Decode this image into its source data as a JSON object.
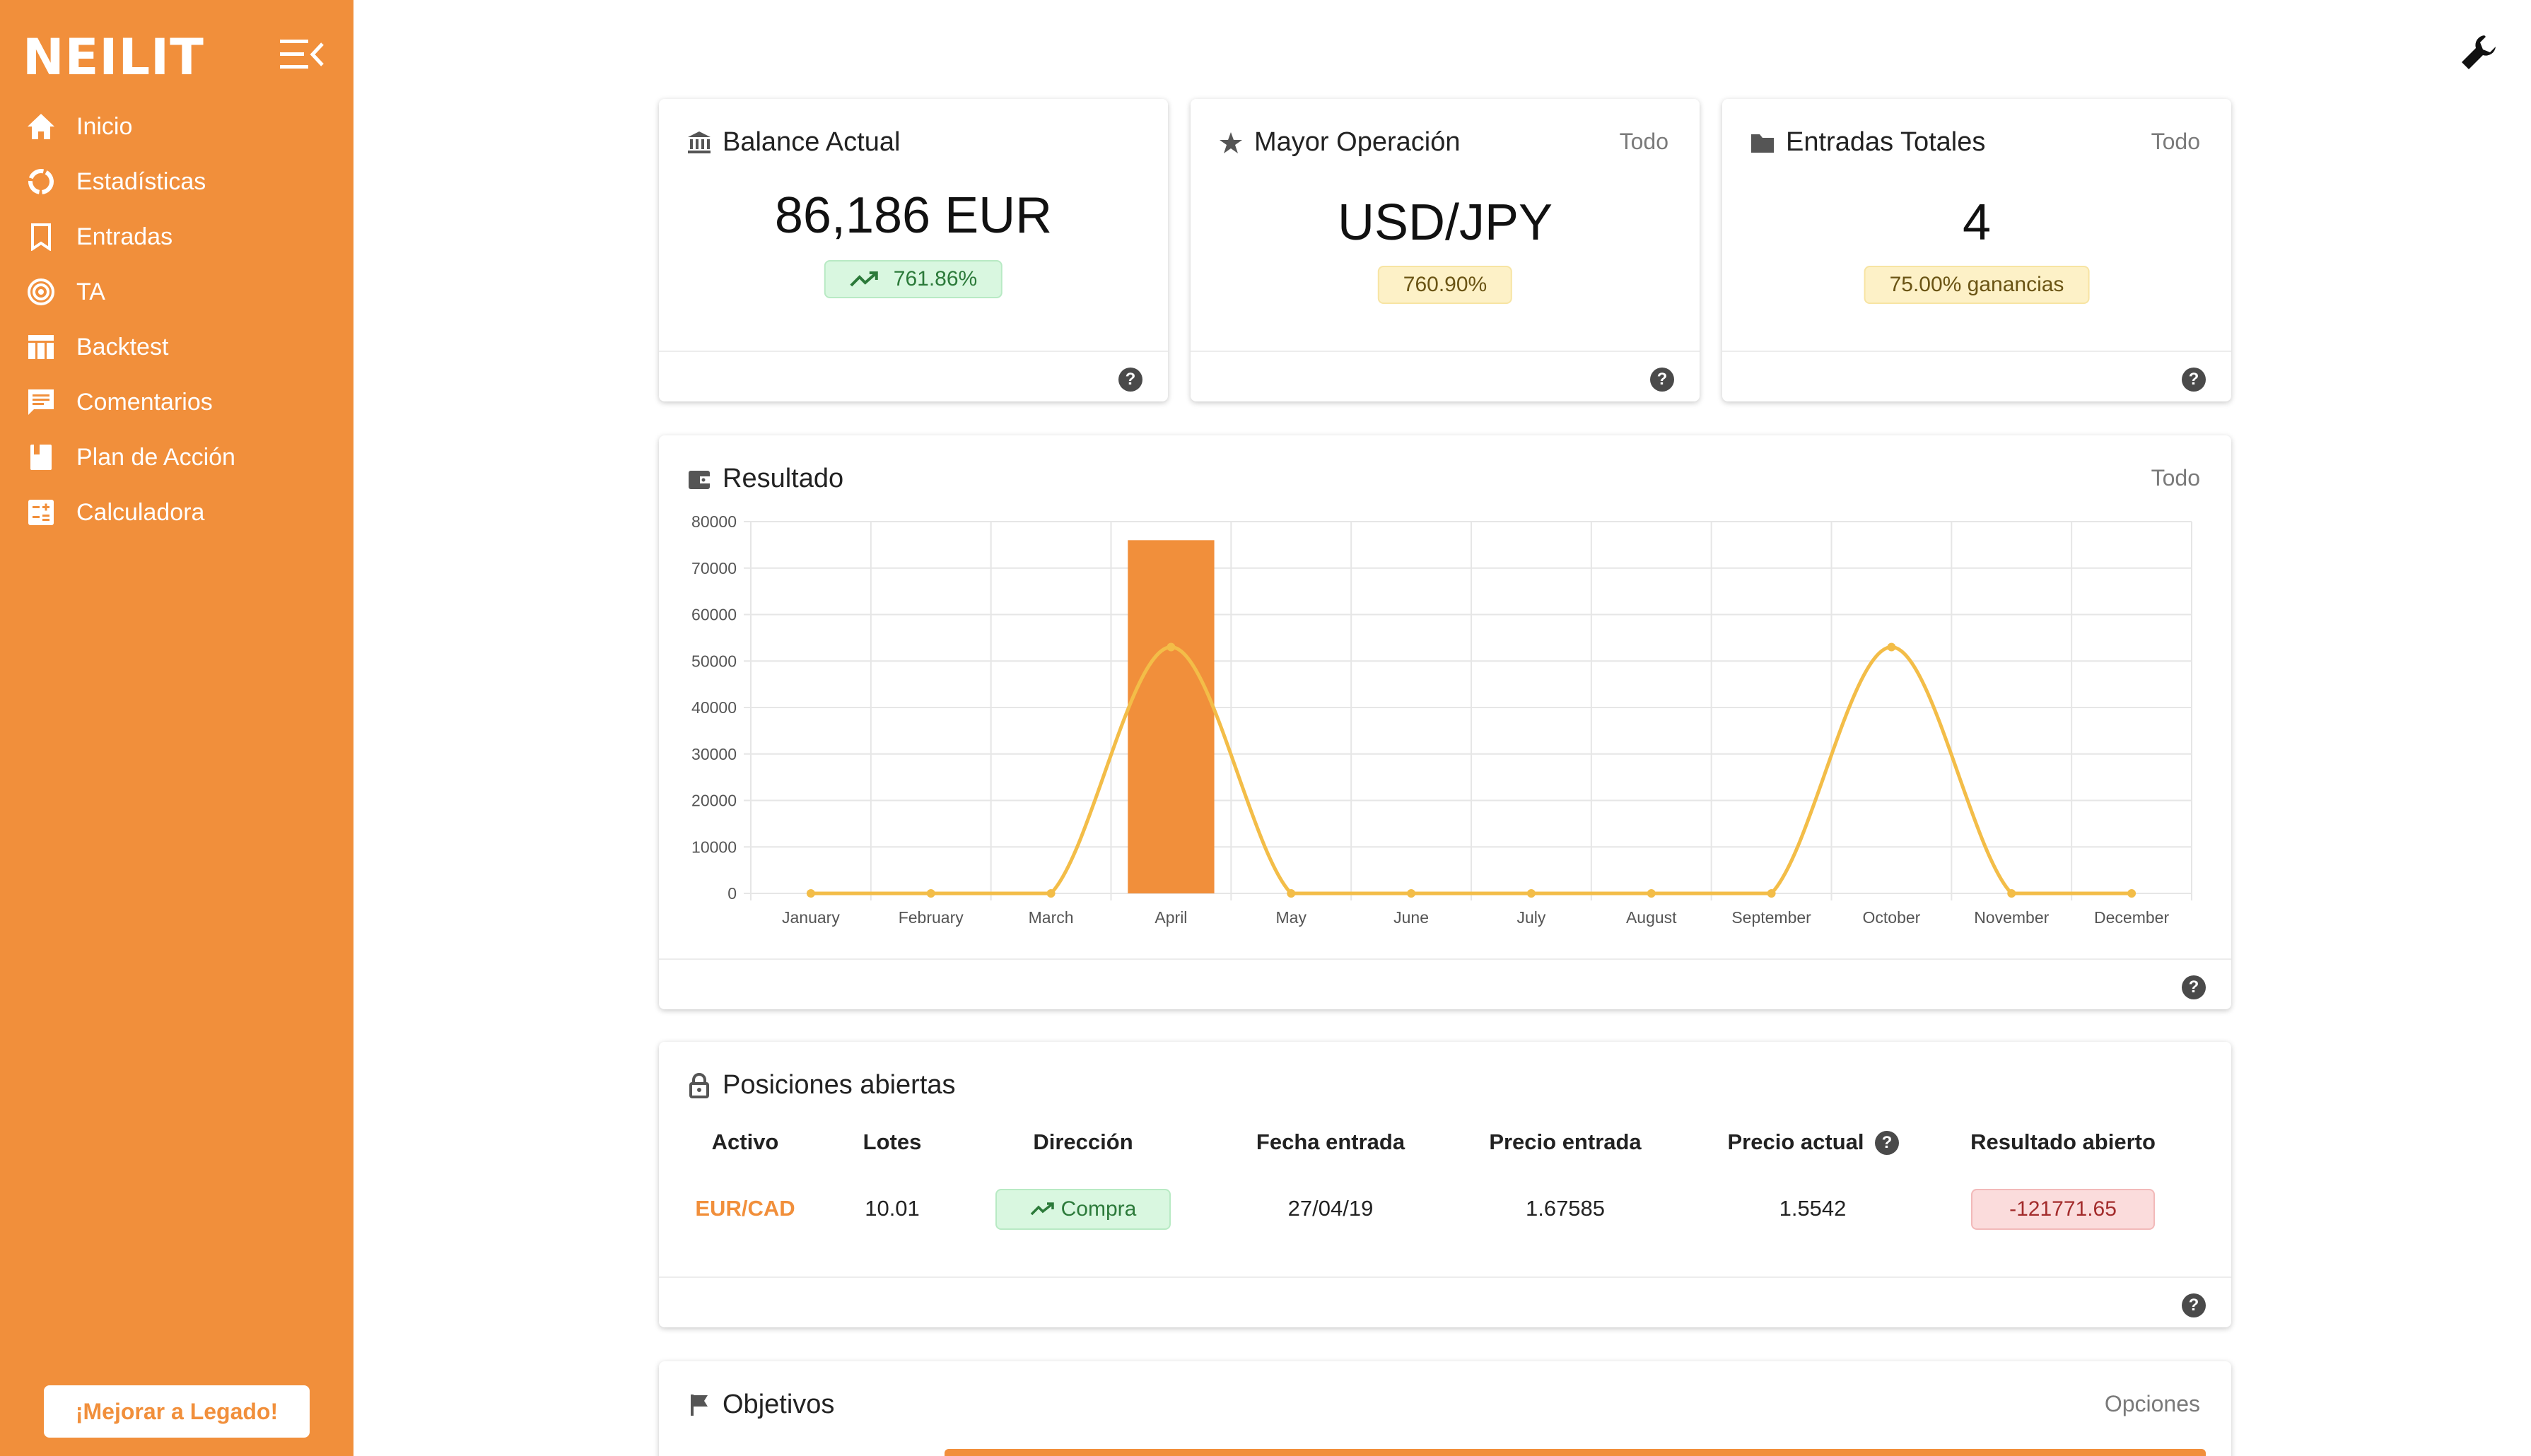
{
  "app": {
    "brand": "NEILIT"
  },
  "sidebar": {
    "items": [
      {
        "label": "Inicio",
        "icon": "home-icon"
      },
      {
        "label": "Estadísticas",
        "icon": "donut-icon"
      },
      {
        "label": "Entradas",
        "icon": "bookmark-icon"
      },
      {
        "label": "TA",
        "icon": "target-icon"
      },
      {
        "label": "Backtest",
        "icon": "table-icon"
      },
      {
        "label": "Comentarios",
        "icon": "comment-icon"
      },
      {
        "label": "Plan de Acción",
        "icon": "book-icon"
      },
      {
        "label": "Calculadora",
        "icon": "calculator-icon"
      }
    ],
    "upgrade_label": "¡Mejorar a Legado!"
  },
  "cards": {
    "balance": {
      "title": "Balance Actual",
      "value": "86,186 EUR",
      "change": "761.86%"
    },
    "best_trade": {
      "title": "Mayor Operación",
      "option": "Todo",
      "value": "USD/JPY",
      "change": "760.90%"
    },
    "entries": {
      "title": "Entradas Totales",
      "option": "Todo",
      "value": "4",
      "change": "75.00% ganancias"
    }
  },
  "result": {
    "title": "Resultado",
    "option": "Todo"
  },
  "chart_data": {
    "type": "bar",
    "title": "",
    "categories": [
      "January",
      "February",
      "March",
      "April",
      "May",
      "June",
      "July",
      "August",
      "September",
      "October",
      "November",
      "December"
    ],
    "series": [
      {
        "type": "bar",
        "values": [
          0,
          0,
          0,
          76000,
          0,
          0,
          0,
          0,
          0,
          0,
          0,
          0
        ],
        "color": "#f18f3b"
      },
      {
        "type": "line",
        "values": [
          0,
          0,
          0,
          53000,
          0,
          0,
          0,
          0,
          0,
          53000,
          0,
          0
        ],
        "color": "#f3bd48"
      }
    ],
    "ylim": [
      0,
      80000
    ],
    "yticks": [
      0,
      10000,
      20000,
      30000,
      40000,
      50000,
      60000,
      70000,
      80000
    ],
    "grid": true
  },
  "positions": {
    "title": "Posiciones abiertas",
    "headers": [
      "Activo",
      "Lotes",
      "Dirección",
      "Fecha entrada",
      "Precio entrada",
      "Precio actual",
      "Resultado abierto"
    ],
    "rows": [
      {
        "asset": "EUR/CAD",
        "lots": "10.01",
        "direction": "Compra",
        "date": "27/04/19",
        "entry_price": "1.67585",
        "current_price": "1.5542",
        "open_result": "-121771.65"
      }
    ]
  },
  "objectives": {
    "title": "Objetivos",
    "option": "Opciones"
  },
  "colors": {
    "accent": "#f18f3b",
    "line": "#f3bd48"
  }
}
